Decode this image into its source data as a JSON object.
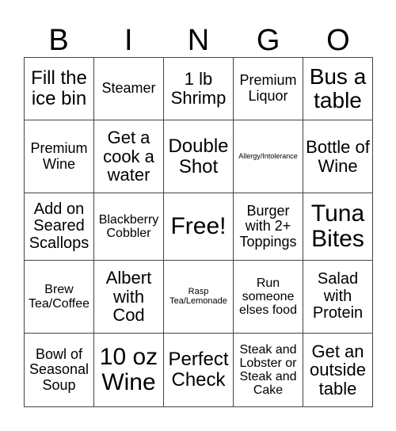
{
  "header": [
    "B",
    "I",
    "N",
    "G",
    "O"
  ],
  "rows": [
    [
      "Fill the ice bin",
      "Steamer",
      "1 lb Shrimp",
      "Premium Liquor",
      "Bus a table"
    ],
    [
      "Premium Wine",
      "Get a cook a water",
      "Double Shot",
      "Allergy/Intolerance",
      "Bottle of Wine"
    ],
    [
      "Add on Seared Scallops",
      "Blackberry Cobbler",
      "Free!",
      "Burger with 2+ Toppings",
      "Tuna Bites"
    ],
    [
      "Brew Tea/Coffee",
      "Albert with Cod",
      "Rasp Tea/Lemonade",
      "Run someone elses food",
      "Salad with Protein"
    ],
    [
      "Bowl of Seasonal Soup",
      "10 oz Wine",
      "Perfect Check",
      "Steak and Lobster or Steak and Cake",
      "Get an outside table"
    ]
  ]
}
